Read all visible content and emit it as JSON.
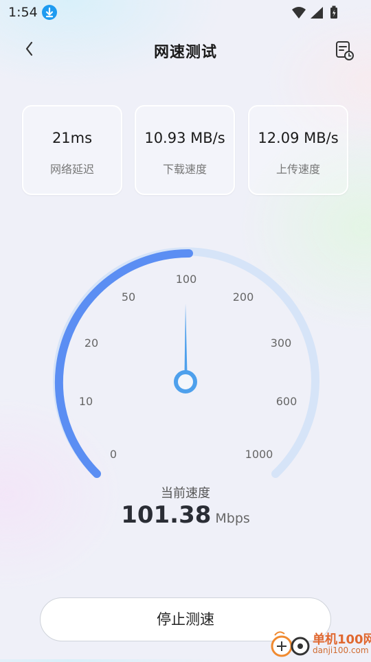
{
  "status_bar": {
    "time": "1:54"
  },
  "header": {
    "title": "网速测试"
  },
  "stats": [
    {
      "value": "21ms",
      "label": "网络延迟"
    },
    {
      "value": "10.93 MB/s",
      "label": "下载速度"
    },
    {
      "value": "12.09 MB/s",
      "label": "上传速度"
    }
  ],
  "gauge": {
    "scale_labels": [
      "0",
      "10",
      "20",
      "50",
      "100",
      "200",
      "300",
      "600",
      "1000"
    ],
    "needle_value": 101.38,
    "colors": {
      "active": "#5b8ef3",
      "track": "#d6e4f8",
      "needle": "#4ea0ec"
    }
  },
  "current_speed": {
    "label": "当前速度",
    "value": "101.38",
    "unit": "Mbps"
  },
  "actions": {
    "stop_label": "停止测速"
  },
  "watermark": {
    "brand": "单机100网",
    "url": "danji100.com"
  }
}
